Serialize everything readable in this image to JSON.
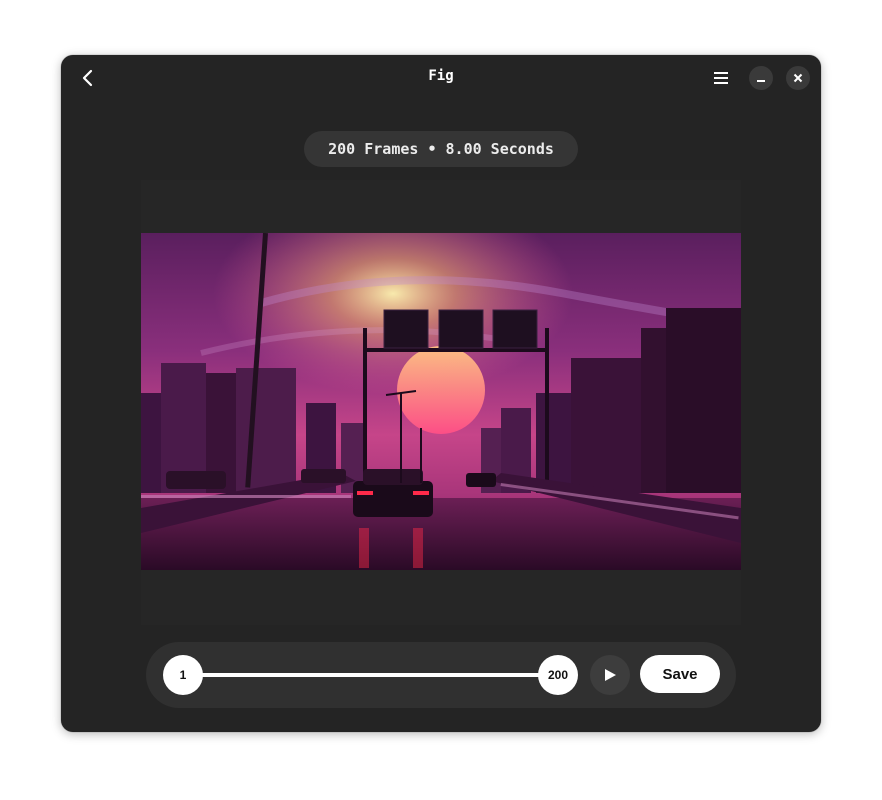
{
  "window": {
    "title": "Fig",
    "icons": {
      "back": "back-arrow-icon",
      "menu": "hamburger-menu-icon",
      "minimize": "minimize-icon",
      "close": "close-icon"
    }
  },
  "info": {
    "summary": "200 Frames • 8.00 Seconds"
  },
  "preview": {
    "scene": "synthwave-city-sunset"
  },
  "controls": {
    "range_start": "1",
    "range_end": "200",
    "play_icon": "play-icon",
    "save_label": "Save"
  },
  "colors": {
    "window_bg": "#242424",
    "pill_bg": "#353535",
    "controls_bg": "#303030",
    "accent_white": "#ffffff"
  }
}
